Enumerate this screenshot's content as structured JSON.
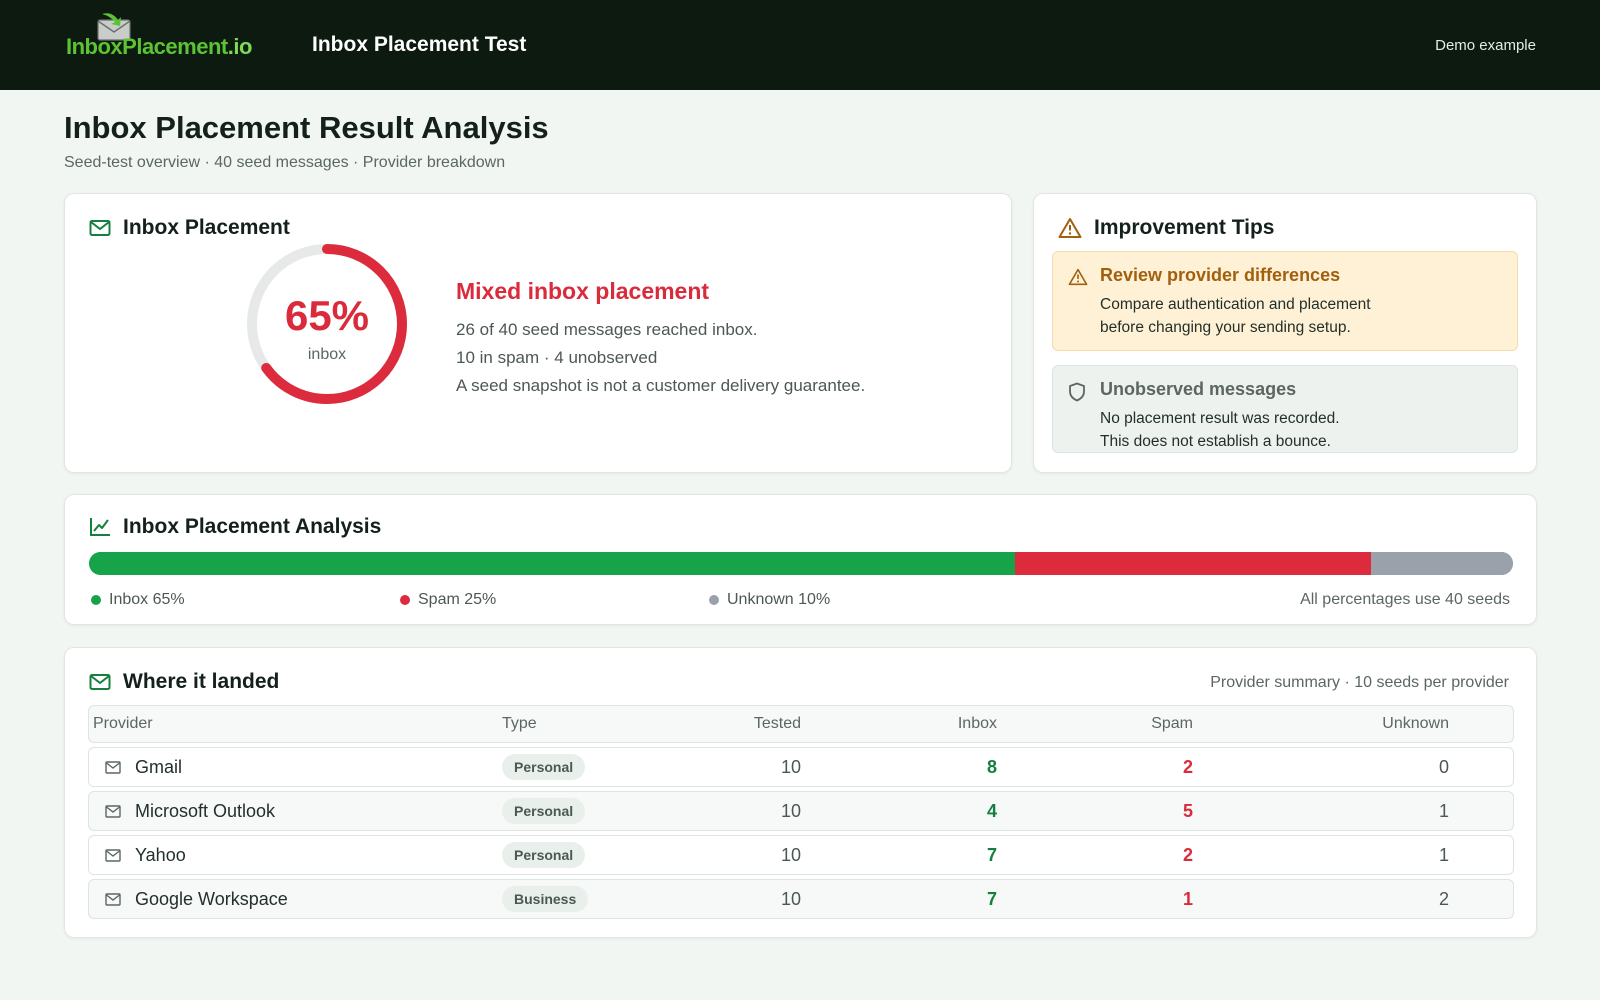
{
  "header": {
    "logo_text_main": "InboxPlacement",
    "logo_text_suffix": ".io",
    "app_title": "Inbox Placement Test",
    "demo_label": "Demo example"
  },
  "page": {
    "title": "Inbox Placement Result Analysis",
    "subtitle": "Seed-test overview · 40 seed messages · Provider breakdown"
  },
  "placement": {
    "title": "Inbox Placement",
    "percent_value": 0.65,
    "percent_label": "65%",
    "percent_caption": "inbox",
    "verdict": "Mixed inbox placement",
    "details": [
      "26 of 40 seed messages reached inbox.",
      "10 in spam · 4 unobserved",
      "A seed snapshot is not a customer delivery guarantee."
    ]
  },
  "tips": {
    "title": "Improvement Tips",
    "items": [
      {
        "title": "Review provider differences",
        "body_lines": [
          "Compare authentication and placement",
          "before changing your sending setup."
        ],
        "icon": "warning-icon"
      },
      {
        "title": "Unobserved messages",
        "body_lines": [
          "No placement result was recorded.",
          "This does not establish a bounce."
        ],
        "icon": "shield-icon"
      }
    ]
  },
  "analysis": {
    "title": "Inbox Placement Analysis",
    "segments": [
      {
        "name": "Inbox",
        "label": "Inbox 65%",
        "fraction": 0.65,
        "color": "#16a34a"
      },
      {
        "name": "Spam",
        "label": "Spam 25%",
        "fraction": 0.25,
        "color": "#dc2b3c"
      },
      {
        "name": "Unknown",
        "label": "Unknown 10%",
        "fraction": 0.1,
        "color": "#9aa1ab"
      }
    ],
    "note": "All percentages use 40 seeds"
  },
  "landed": {
    "title": "Where it landed",
    "meta": "Provider summary · 10 seeds per provider",
    "columns": [
      "Provider",
      "Type",
      "Tested",
      "Inbox",
      "Spam",
      "Unknown"
    ],
    "rows": [
      {
        "provider": "Gmail",
        "type": "Personal",
        "tested": "10",
        "inbox": "8",
        "spam": "2",
        "unknown": "0"
      },
      {
        "provider": "Microsoft Outlook",
        "type": "Personal",
        "tested": "10",
        "inbox": "4",
        "spam": "5",
        "unknown": "1"
      },
      {
        "provider": "Yahoo",
        "type": "Personal",
        "tested": "10",
        "inbox": "7",
        "spam": "2",
        "unknown": "1"
      },
      {
        "provider": "Google Workspace",
        "type": "Business",
        "tested": "10",
        "inbox": "7",
        "spam": "1",
        "unknown": "2"
      }
    ]
  },
  "colors": {
    "accent_green": "#16a34a",
    "spam_red": "#d92b3c",
    "unknown_gray": "#9aa1ab",
    "header_bg": "#0c1a10"
  }
}
